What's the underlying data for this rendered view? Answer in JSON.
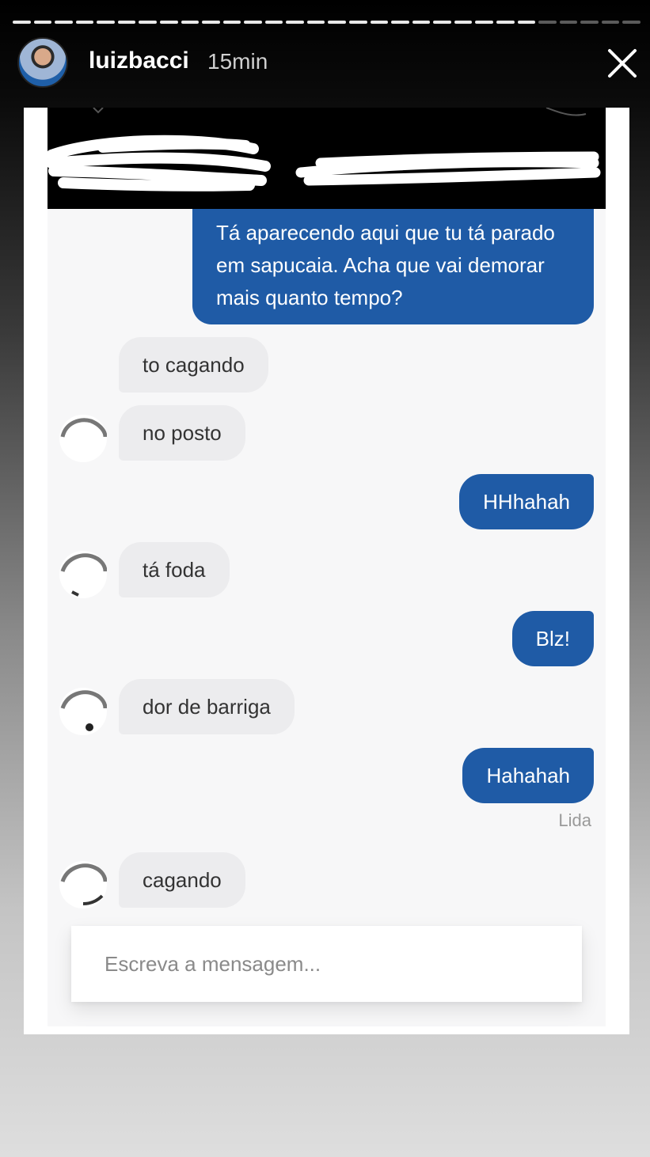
{
  "story": {
    "username": "luizbacci",
    "time_ago": "15min",
    "progress_segments_total": 30,
    "progress_segments_viewed": 25
  },
  "chat": {
    "messages": [
      {
        "side": "out",
        "text": "Tá aparecendo aqui que tu tá parado em sapucaia. Acha que vai demorar mais quanto tempo?"
      },
      {
        "side": "in",
        "text": "to cagando"
      },
      {
        "side": "in",
        "text": "no posto"
      },
      {
        "side": "out",
        "text": "HHhahah"
      },
      {
        "side": "in",
        "text": "tá foda"
      },
      {
        "side": "out",
        "text": "Blz!"
      },
      {
        "side": "in",
        "text": "dor de barriga"
      },
      {
        "side": "out",
        "text": "Hahahah"
      },
      {
        "side": "in",
        "text": "cagando"
      }
    ],
    "read_receipt": "Lida",
    "composer_placeholder": "Escreva a mensagem..."
  },
  "colors": {
    "outgoing_bubble": "#1f5ba6",
    "incoming_bubble": "#ececee",
    "chat_background": "#f7f7f8"
  }
}
